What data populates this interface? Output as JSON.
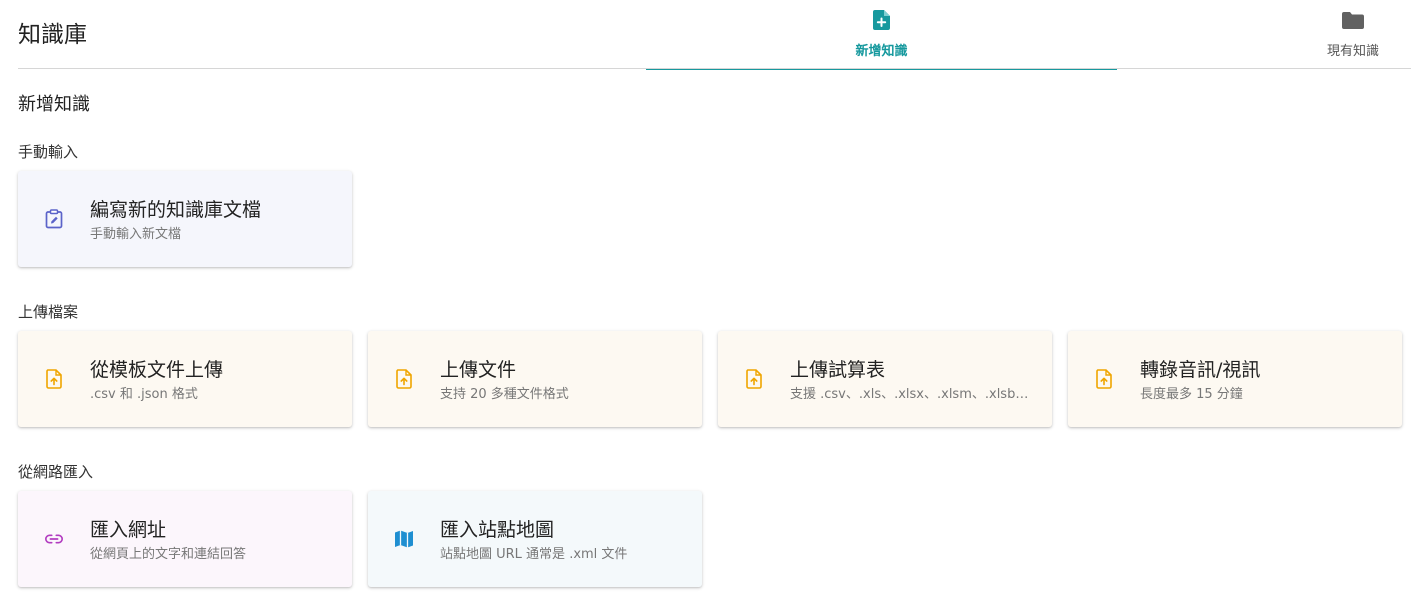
{
  "header": {
    "title": "知識庫",
    "tabs": [
      {
        "label": "新增知識",
        "icon": "file-plus-icon",
        "active": true
      },
      {
        "label": "現有知識",
        "icon": "folder-icon",
        "active": false
      }
    ]
  },
  "main": {
    "heading": "新增知識",
    "groups": [
      {
        "label": "手動輸入",
        "cards": [
          {
            "title": "編寫新的知識庫文檔",
            "desc": "手動輸入新文檔",
            "icon": "clipboard-edit-icon"
          }
        ]
      },
      {
        "label": "上傳檔案",
        "cards": [
          {
            "title": "從模板文件上傳",
            "desc": ".csv 和 .json 格式",
            "icon": "file-upload-icon"
          },
          {
            "title": "上傳文件",
            "desc": "支持 20 多種文件格式",
            "icon": "file-upload-icon"
          },
          {
            "title": "上傳試算表",
            "desc": "支援 .csv、.xls、.xlsx、.xlsm、.xlsb、.ods",
            "icon": "file-upload-icon"
          },
          {
            "title": "轉錄音訊/視訊",
            "desc": "長度最多 15 分鐘",
            "icon": "file-upload-icon"
          }
        ]
      },
      {
        "label": "從網路匯入",
        "cards": [
          {
            "title": "匯入網址",
            "desc": "從網頁上的文字和連結回答",
            "icon": "link-icon"
          },
          {
            "title": "匯入站點地圖",
            "desc": "站點地圖 URL 通常是 .xml 文件",
            "icon": "map-icon"
          }
        ]
      }
    ]
  },
  "colors": {
    "accent": "#17999e",
    "manual_icon": "#5b63c9",
    "upload_icon": "#f0a500",
    "url_icon": "#b23cc0",
    "sitemap_icon": "#1e8fd1"
  }
}
